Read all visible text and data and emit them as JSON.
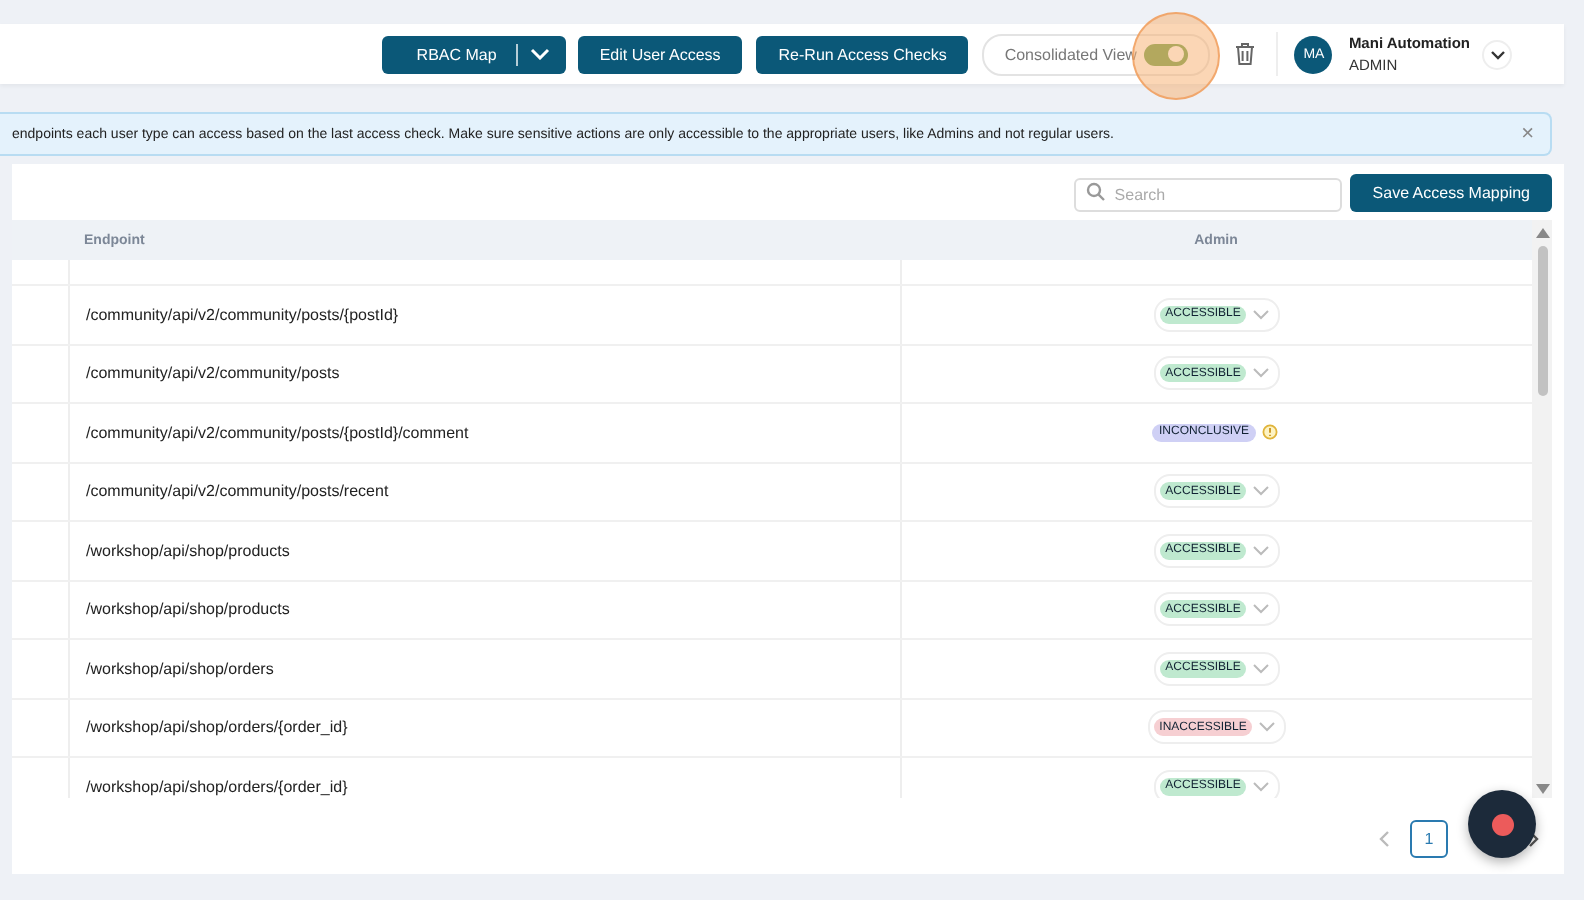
{
  "toolbar": {
    "rbac_map": "RBAC Map",
    "edit_user_access": "Edit User Access",
    "rerun_checks": "Re-Run Access Checks",
    "consolidated_view": {
      "label": "Consolidated View",
      "on": true
    },
    "user": {
      "initials": "MA",
      "name": "Mani Automation",
      "role": "ADMIN"
    }
  },
  "banner": {
    "text": "endpoints each user type can access based on the last access check. Make sure sensitive actions are only accessible to the appropriate users, like Admins and not regular users.",
    "close": "×"
  },
  "search": {
    "placeholder": "Search"
  },
  "save_button": "Save Access Mapping",
  "table": {
    "columns": [
      "Endpoint",
      "Admin"
    ],
    "rows": [
      {
        "endpoint": "/community/api/v2/community/posts/{postId}",
        "status": "ACCESSIBLE",
        "kind": "accessible"
      },
      {
        "endpoint": "/community/api/v2/community/posts",
        "status": "ACCESSIBLE",
        "kind": "accessible"
      },
      {
        "endpoint": "/community/api/v2/community/posts/{postId}/comment",
        "status": "INCONCLUSIVE",
        "kind": "inconclusive"
      },
      {
        "endpoint": "/community/api/v2/community/posts/recent",
        "status": "ACCESSIBLE",
        "kind": "accessible"
      },
      {
        "endpoint": "/workshop/api/shop/products",
        "status": "ACCESSIBLE",
        "kind": "accessible"
      },
      {
        "endpoint": "/workshop/api/shop/products",
        "status": "ACCESSIBLE",
        "kind": "accessible"
      },
      {
        "endpoint": "/workshop/api/shop/orders",
        "status": "ACCESSIBLE",
        "kind": "accessible"
      },
      {
        "endpoint": "/workshop/api/shop/orders/{order_id}",
        "status": "INACCESSIBLE",
        "kind": "inaccessible"
      },
      {
        "endpoint": "/workshop/api/shop/orders/{order_id}",
        "status": "ACCESSIBLE",
        "kind": "accessible"
      }
    ]
  },
  "pagination": {
    "pages": [
      {
        "label": "1",
        "selected": true
      }
    ]
  }
}
